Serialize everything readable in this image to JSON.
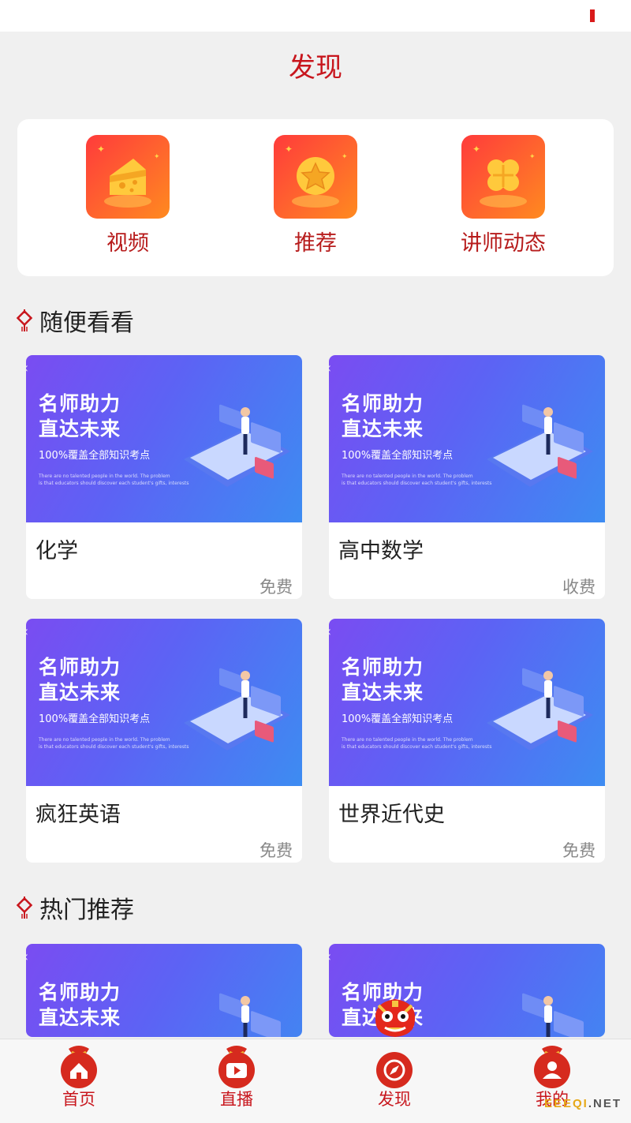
{
  "header": {
    "title": "发现"
  },
  "quick_links": [
    {
      "label": "视频",
      "icon": "cheese-icon"
    },
    {
      "label": "推荐",
      "icon": "star-coin-icon"
    },
    {
      "label": "讲师动态",
      "icon": "clover-icon"
    }
  ],
  "sections": [
    {
      "title": "随便看看",
      "courses": [
        {
          "title": "化学",
          "price": "免费"
        },
        {
          "title": "高中数学",
          "price": "收费"
        },
        {
          "title": "疯狂英语",
          "price": "免费"
        },
        {
          "title": "世界近代史",
          "price": "免费"
        }
      ]
    },
    {
      "title": "热门推荐",
      "courses": [
        {
          "title": "",
          "price": ""
        },
        {
          "title": "",
          "price": ""
        }
      ]
    }
  ],
  "banner": {
    "line1": "名师助力",
    "line2": "直达未来",
    "sub": "100%覆盖全部知识考点",
    "en1": "There are no talented people in the world. The problem",
    "en2": "is that educators should discover each student's gifts, interests"
  },
  "tabbar": [
    {
      "label": "首页",
      "icon": "home-icon"
    },
    {
      "label": "直播",
      "icon": "play-icon"
    },
    {
      "label": "发现",
      "icon": "compass-icon",
      "active": true
    },
    {
      "label": "我的",
      "icon": "user-icon"
    }
  ],
  "watermark": {
    "prefix": "EEEQI",
    "suffix": ".NET"
  },
  "colors": {
    "brand_red": "#c8161d",
    "banner_start": "#7a4cf2",
    "banner_end": "#3d8cf2",
    "background": "#f0f0f0"
  }
}
